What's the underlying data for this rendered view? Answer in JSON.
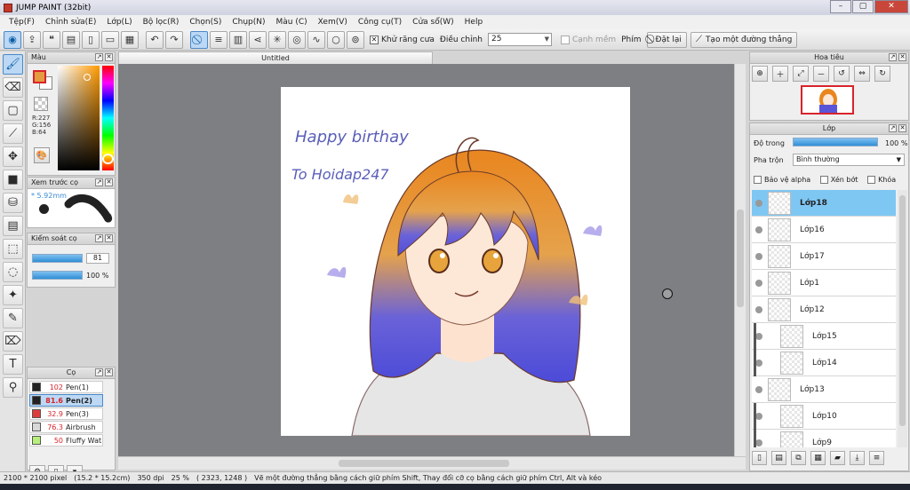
{
  "window": {
    "title": "JUMP PAINT (32bit)",
    "min": "–",
    "max": "▢",
    "close": "✕"
  },
  "menu": [
    "Tệp(F)",
    "Chỉnh sửa(E)",
    "Lớp(L)",
    "Bộ lọc(R)",
    "Chọn(S)",
    "Chụp(N)",
    "Màu (C)",
    "Xem(V)",
    "Công cụ(T)",
    "Cửa sổ(W)",
    "Help"
  ],
  "toolbar": {
    "antialias_label": "Khử răng cưa",
    "adjust_label": "Điều chỉnh",
    "adjust_value": "25",
    "edge_label": "Cạnh mềm",
    "key_label": "Phím",
    "reset_label": "Đặt lại",
    "line_label": "Tạo một đường thẳng"
  },
  "panels": {
    "color": "Màu",
    "brush_preview": "Xem trước cọ",
    "brush_control": "Kiểm soát cọ",
    "brush": "Cọ",
    "navigator": "Hoa tiêu",
    "layer": "Lớp"
  },
  "color": {
    "r": "R:227",
    "g": "G:156",
    "b": "B:64",
    "fg_hex": "#e39c40"
  },
  "brush_preview": {
    "size": "5.92mm"
  },
  "brush_control": {
    "size_value": "81",
    "opacity_value": "100 %"
  },
  "brushes": [
    {
      "size": "102",
      "name": "Pen(1)",
      "color": "#222222"
    },
    {
      "size": "81.6",
      "name": "Pen(2)",
      "color": "#222222"
    },
    {
      "size": "32.9",
      "name": "Pen(3)",
      "color": "#e03b3b"
    },
    {
      "size": "76.3",
      "name": "Airbrush",
      "color": "#d8d8d8"
    },
    {
      "size": "50",
      "name": "Fluffy Wat",
      "color": "#b6f07a"
    }
  ],
  "canvas": {
    "tab": "Untitled",
    "art_text_1": "Happy birthay",
    "art_text_2": "To Hoidap247"
  },
  "layer_panel": {
    "opacity_label": "Độ trong",
    "opacity_value": "100 %",
    "blend_label": "Pha trộn",
    "blend_value": "Bình thường",
    "protect_alpha": "Bảo vệ alpha",
    "clip": "Xén bớt",
    "lock": "Khóa"
  },
  "layers": [
    {
      "name": "Lớp18",
      "child": false
    },
    {
      "name": "Lớp16",
      "child": false
    },
    {
      "name": "Lớp17",
      "child": false
    },
    {
      "name": "Lớp1",
      "child": false
    },
    {
      "name": "Lớp12",
      "child": false
    },
    {
      "name": "Lớp15",
      "child": true
    },
    {
      "name": "Lớp14",
      "child": true
    },
    {
      "name": "Lớp13",
      "child": false
    },
    {
      "name": "Lớp10",
      "child": true
    },
    {
      "name": "Lớp9",
      "child": true
    }
  ],
  "status": {
    "size": "2100 * 2100 pixel",
    "cm": "(15.2 * 15.2cm)",
    "dpi": "350 dpi",
    "zoom": "25 %",
    "coords": "( 2323, 1248 )",
    "hint": "Vẽ một đường thẳng bằng cách giữ phím Shift, Thay đổi cỡ cọ bằng cách giữ phím Ctrl, Alt và kéo"
  }
}
